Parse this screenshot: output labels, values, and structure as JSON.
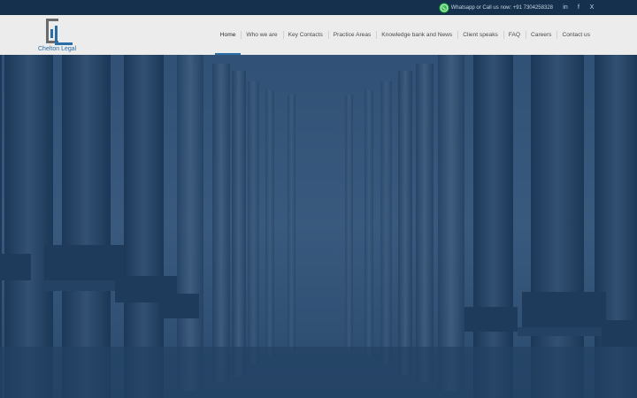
{
  "topbar": {
    "contact_text": "Whatsapp or Call us now: +91 7304258328",
    "social": [
      {
        "label": "in",
        "icon": "linkedin-icon"
      },
      {
        "label": "f",
        "icon": "facebook-icon"
      },
      {
        "label": "X",
        "icon": "x-icon"
      }
    ]
  },
  "brand": {
    "name": "Chelton Legal",
    "accent": "#2a6ea8"
  },
  "nav": {
    "items": [
      {
        "label": "Home",
        "active": true
      },
      {
        "label": "Who we are"
      },
      {
        "label": "Key Contacts"
      },
      {
        "label": "Practice Areas"
      },
      {
        "label": "Knowledge bank and News"
      },
      {
        "label": "Client speaks"
      },
      {
        "label": "FAQ"
      },
      {
        "label": "Careers"
      },
      {
        "label": "Contact us"
      }
    ]
  },
  "colors": {
    "topbar": "#14304d",
    "header": "#ececec",
    "hero_overlay": "#1f3c5f"
  }
}
